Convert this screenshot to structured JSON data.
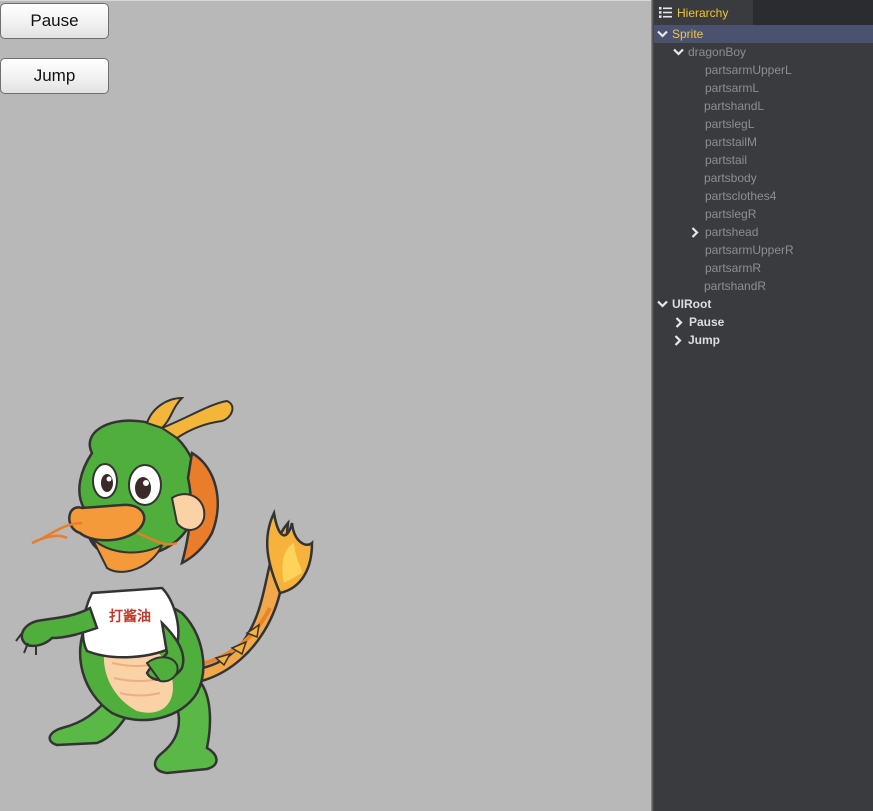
{
  "game": {
    "pause_label": "Pause",
    "jump_label": "Jump",
    "shirt_text": "打酱油"
  },
  "hierarchy": {
    "tab_title": "Hierarchy",
    "tab_icon": "list-icon",
    "nodes": {
      "sprite": "Sprite",
      "dragonboy": "dragonBoy",
      "parts": [
        "partsarmUpperL",
        "partsarmL",
        "partshandL",
        "partslegL",
        "partstailM",
        "partstail",
        "partsbody",
        "partsclothes4",
        "partslegR",
        "partshead",
        "partsarmUpperR",
        "partsarmR",
        "partshandR"
      ],
      "uiroot": "UIRoot",
      "uiroot_children": [
        "Pause",
        "Jump"
      ]
    }
  },
  "colors": {
    "stage_bg": "#b8b8b8",
    "panel_bg": "#3a3b3f",
    "tab_text": "#f2c530",
    "selected_row": "#4a5270",
    "dragon_green": "#4fae3c"
  }
}
